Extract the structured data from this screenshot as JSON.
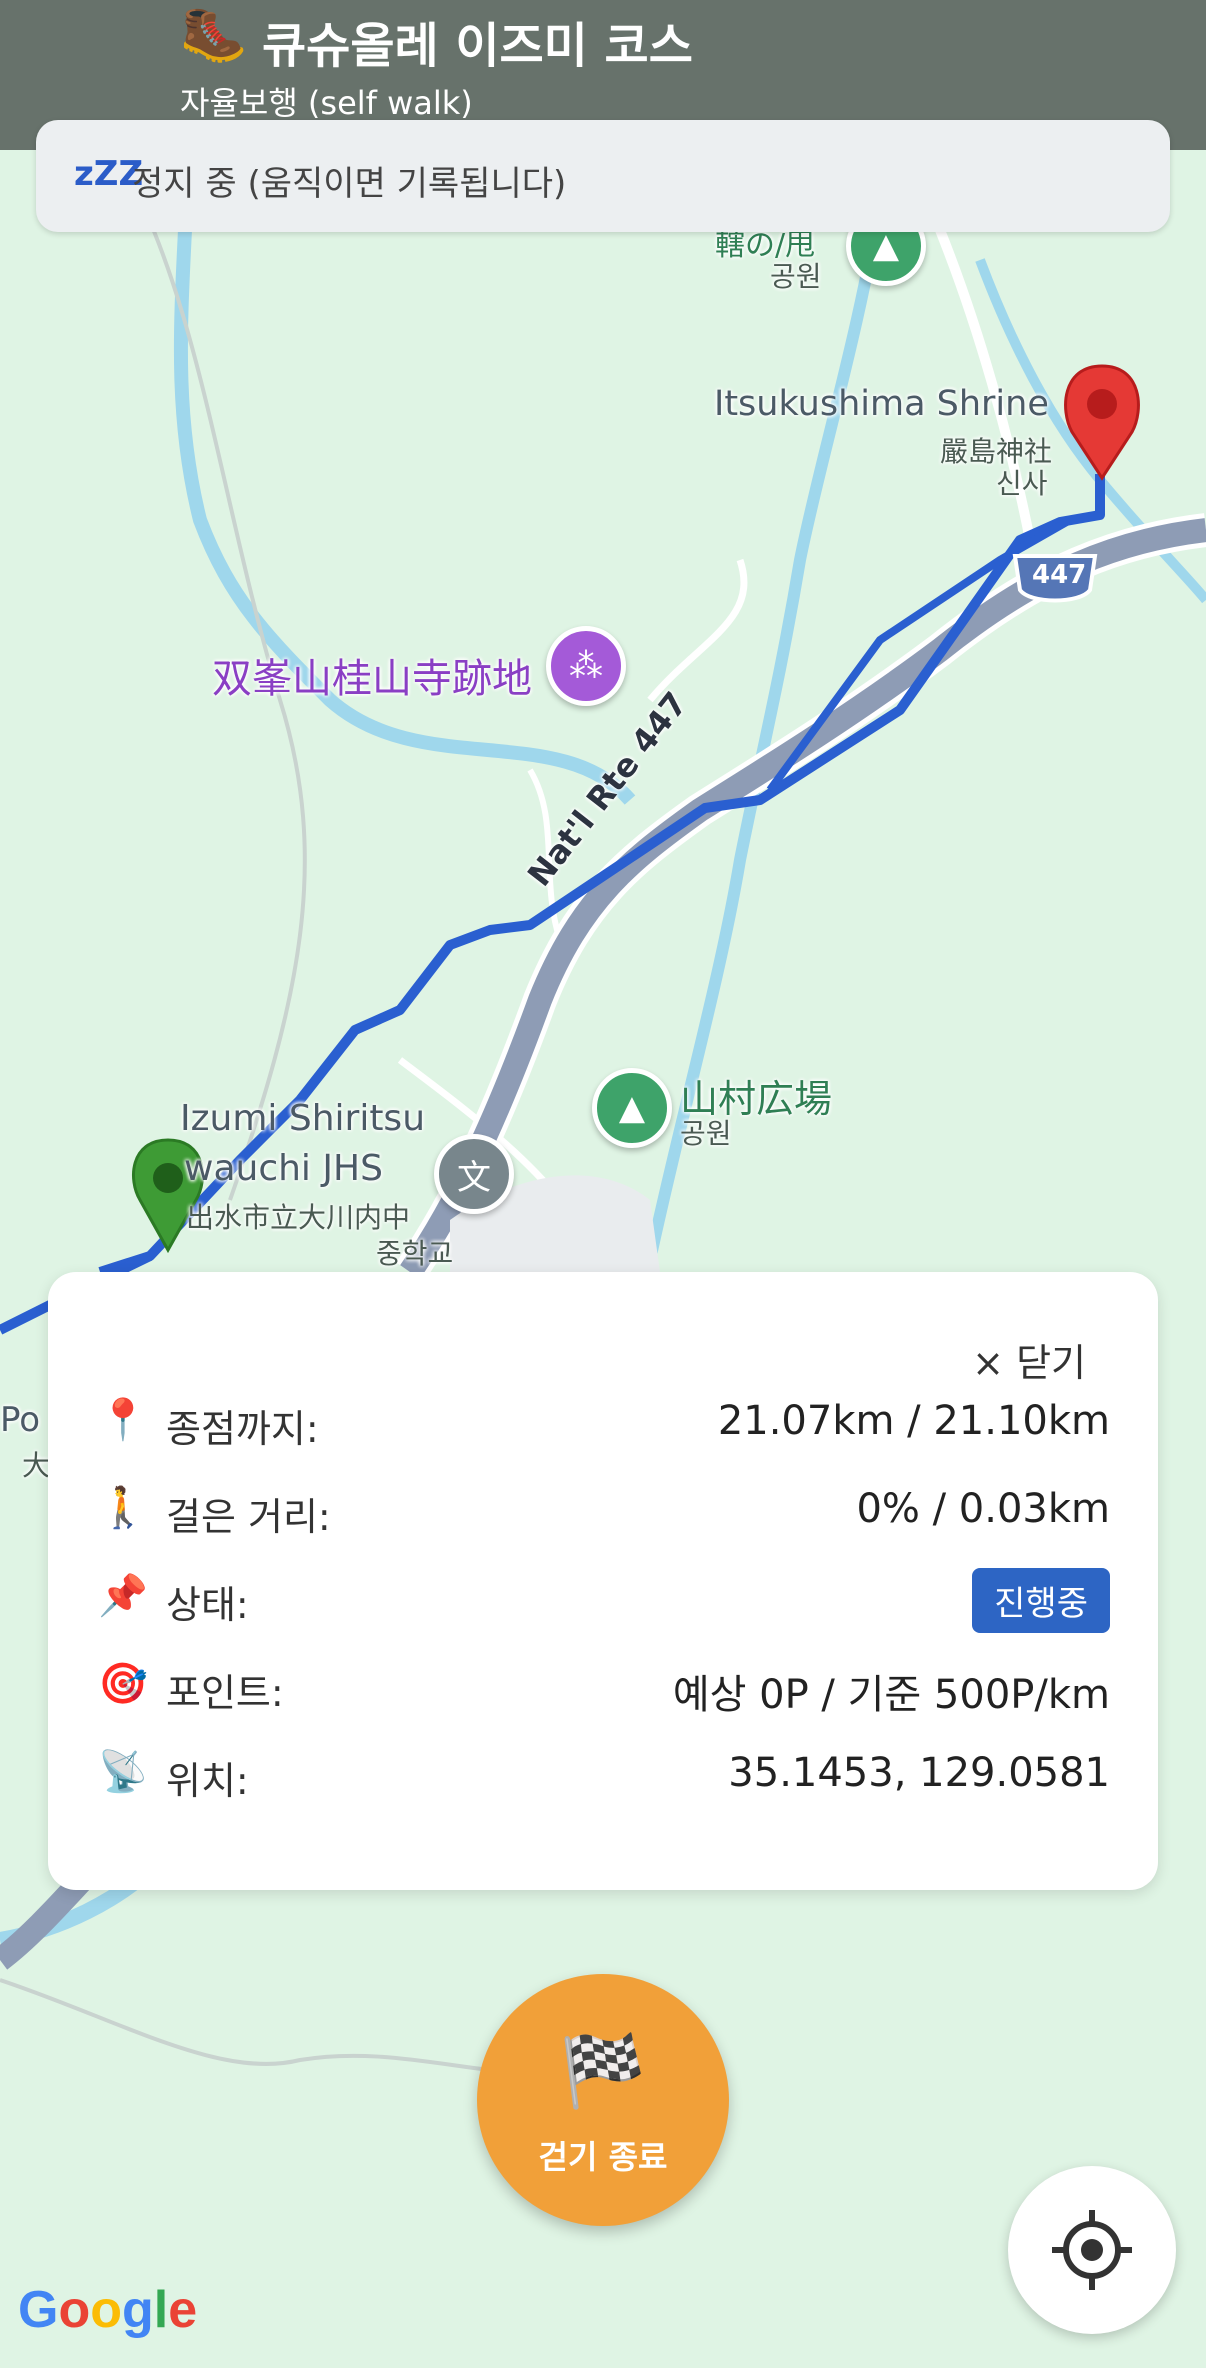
{
  "header": {
    "title": "큐슈올레 이즈미 코스",
    "title_icon": "🥾",
    "subtitle": "자율보행 (self walk)"
  },
  "status": {
    "icon": "zzz-icon",
    "icon_text": "zZZ",
    "text": "정지 중 (움직이면 기록됩니다)"
  },
  "map": {
    "labels": {
      "top_partial": "轄の/甩",
      "top_partial_sub": "공원",
      "shrine_en": "Itsukushima Shrine",
      "shrine_jp": "嚴島神社",
      "shrine_ko": "신사",
      "route_badge": "447",
      "temple": "双峯山桂山寺跡地",
      "road": "Nat'l Rte 447",
      "plaza": "山村広場",
      "plaza_sub": "공원",
      "school_en_1": "Izumi Shiritsu",
      "school_en_2": "wauchi JHS",
      "school_jp": "出水市立大川内中",
      "school_ko": "중학교",
      "left_partial": "Po",
      "left_partial_jp": "大"
    },
    "colors": {
      "background": "#dff4e4",
      "river": "#9fd7ec",
      "road": "#8e9cb5",
      "route": "#2a5fd0",
      "start_pin": "#3e9b35",
      "end_pin": "#e53935"
    }
  },
  "card": {
    "close_label": "× 닫기",
    "rows": [
      {
        "icon": "📍",
        "label": "종점까지:",
        "value": "21.07km / 21.10km"
      },
      {
        "icon": "🚶",
        "label": "걸은 거리:",
        "value": "0% / 0.03km"
      },
      {
        "icon": "📌",
        "label": "상태:",
        "value": "진행중"
      },
      {
        "icon": "🎯",
        "label": "포인트:",
        "value": "예상 0P / 기준 500P/km"
      },
      {
        "icon": "📡",
        "label": "위치:",
        "value": "35.1453, 129.0581"
      }
    ]
  },
  "finish": {
    "icon": "🏁",
    "label": "걷기 종료"
  },
  "google": {
    "text": "Google"
  }
}
